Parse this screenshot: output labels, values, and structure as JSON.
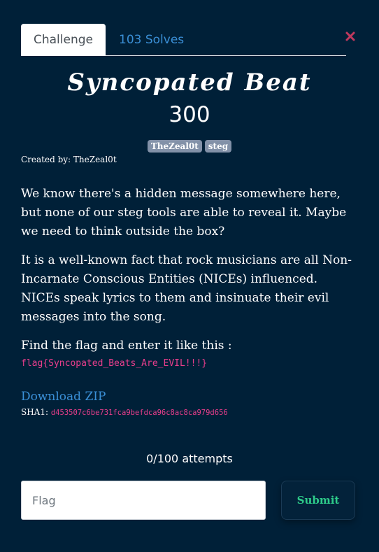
{
  "tabs": {
    "challenge": "Challenge",
    "solves": "103 Solves"
  },
  "close": {
    "icon": "close-icon",
    "color": "#c0395e"
  },
  "challenge": {
    "title": "Syncopated Beat",
    "points": "300",
    "tags": [
      "TheZeal0t",
      "steg"
    ],
    "created_by": "Created by: TheZeal0t",
    "description": [
      "We know there's a hidden message somewhere here, but none of our steg tools are able to reveal it. Maybe we need to think outside the box?",
      "It is a well-known fact that rock musicians are all Non-Incarnate Conscious Entities (NICEs) influenced. NICEs speak lyrics to them and insinuate their evil messages into the song.",
      "Find the flag and enter it like this :"
    ],
    "flag_example": "flag{Syncopated_Beats_Are_EVIL!!!}",
    "download_label": "Download ZIP",
    "sha_label": "SHA1:",
    "sha_value": "d453507c6be731fca9befdca96c8ac8ca979d656"
  },
  "submission": {
    "attempts": "0/100 attempts",
    "placeholder": "Flag",
    "submit_label": "Submit"
  },
  "colors": {
    "background": "#002038",
    "link": "#3a8fd6",
    "code": "#e83e8c",
    "submit_text": "#2ecc8a"
  }
}
